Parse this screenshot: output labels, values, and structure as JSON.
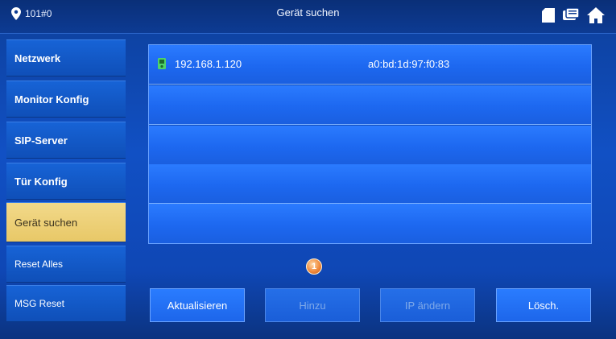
{
  "header": {
    "location": "101#0",
    "title": "Gerät suchen"
  },
  "sidebar": {
    "items": [
      {
        "label": "Netzwerk"
      },
      {
        "label": "Monitor Konfig"
      },
      {
        "label": "SIP-Server"
      },
      {
        "label": "Tür Konfig"
      },
      {
        "label": "Gerät suchen",
        "active": true
      },
      {
        "label": "Reset Alles"
      },
      {
        "label": "MSG Reset"
      }
    ]
  },
  "device_list": {
    "rows": [
      {
        "ip": "192.168.1.120",
        "mac": "a0:bd:1d:97:f0:83"
      },
      {
        "ip": "",
        "mac": ""
      },
      {
        "ip": "",
        "mac": ""
      },
      {
        "ip": "",
        "mac": ""
      },
      {
        "ip": "",
        "mac": ""
      }
    ]
  },
  "pager": {
    "page": "1"
  },
  "buttons": {
    "refresh": "Aktualisieren",
    "add": "Hinzu",
    "change_ip": "IP ändern",
    "delete": "Lösch."
  },
  "colors": {
    "active_item": "#e8c867",
    "accent_blue": "#1d68f0",
    "pager_orange": "#f08a3c"
  }
}
